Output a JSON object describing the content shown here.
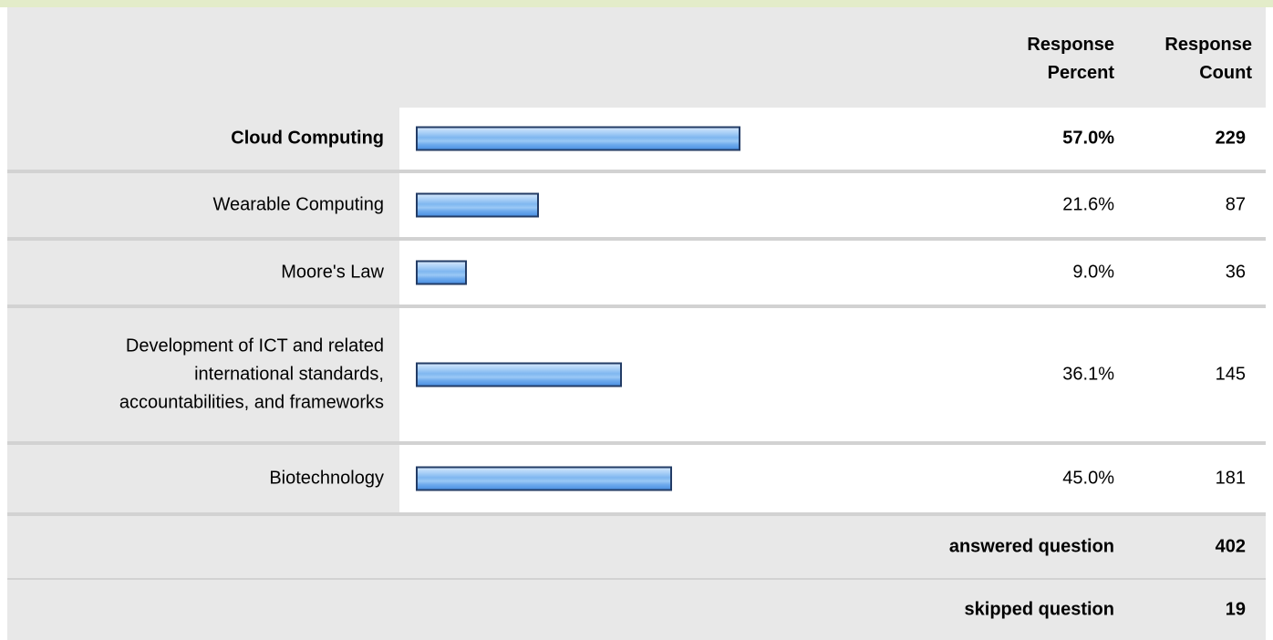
{
  "header": {
    "percent_line1": "Response",
    "percent_line2": "Percent",
    "count_line1": "Response",
    "count_line2": "Count"
  },
  "chart_data": {
    "type": "bar",
    "orientation": "horizontal",
    "categories": [
      "Cloud Computing",
      "Wearable Computing",
      "Moore's Law",
      "Development of ICT and related international standards, accountabilities, and frameworks",
      "Biotechnology"
    ],
    "label_lines": [
      [
        "Cloud Computing"
      ],
      [
        "Wearable Computing"
      ],
      [
        "Moore's Law"
      ],
      [
        "Development of ICT and related",
        "international standards,",
        "accountabilities, and frameworks"
      ],
      [
        "Biotechnology"
      ]
    ],
    "values": [
      57.0,
      21.6,
      9.0,
      36.1,
      45.0
    ],
    "percent_labels": [
      "57.0%",
      "21.6%",
      "9.0%",
      "36.1%",
      "45.0%"
    ],
    "counts": [
      "229",
      "87",
      "36",
      "145",
      "181"
    ],
    "highlight_index": 0,
    "xlim": [
      0,
      100
    ],
    "bar_color": "#7fb7f0",
    "bar_border_color": "#233c66"
  },
  "summary": {
    "answered_label": "answered question",
    "answered_value": "402",
    "skipped_label": "skipped question",
    "skipped_value": "19"
  },
  "colors": {
    "header_bg": "#e8e8e8",
    "top_strip": "#e3ecc9",
    "row_separator": "#d2d2d2"
  }
}
